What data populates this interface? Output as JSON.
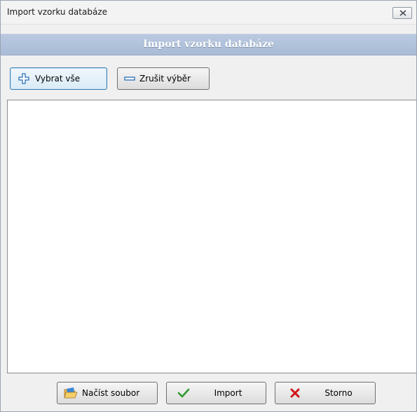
{
  "window": {
    "title": "Import vzorku databáze",
    "close_icon": "close-icon"
  },
  "header": {
    "title": "Import vzorku databáze"
  },
  "toolbar": {
    "select_all_label": "Vybrat vše",
    "select_all_icon": "plus-icon",
    "deselect_label": "Zrušit výběr",
    "deselect_icon": "minus-icon"
  },
  "list": {
    "items": []
  },
  "footer": {
    "load_file_label": "Načíst soubor",
    "load_file_icon": "folder-open-icon",
    "import_label": "Import",
    "import_icon": "checkmark-icon",
    "cancel_label": "Storno",
    "cancel_icon": "red-x-icon"
  },
  "colors": {
    "header_band": "#b0c2dc",
    "accent_blue": "#3c7fb1",
    "check_green": "#2f9a2f",
    "cancel_red": "#d01818"
  }
}
